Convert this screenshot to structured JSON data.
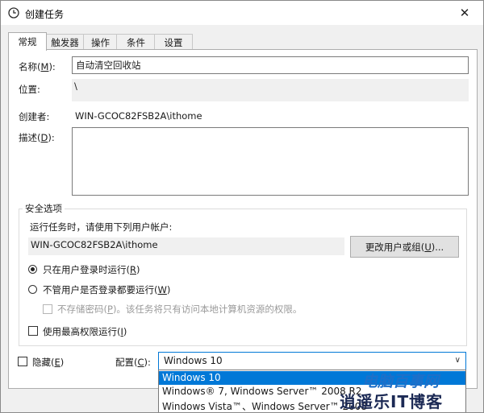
{
  "window": {
    "title": "创建任务",
    "close_glyph": "✕"
  },
  "tabs": [
    {
      "label": "常规",
      "active": true
    },
    {
      "label": "触发器",
      "active": false
    },
    {
      "label": "操作",
      "active": false
    },
    {
      "label": "条件",
      "active": false
    },
    {
      "label": "设置",
      "active": false
    }
  ],
  "general": {
    "name_label": "名称(",
    "name_key": "M",
    "name_label_end": "):",
    "name_value": "自动清空回收站",
    "location_label": "位置:",
    "location_value": "\\",
    "author_label": "创建者:",
    "author_value": "WIN-GCOC82FSB2A\\ithome",
    "description_label": "描述(",
    "description_key": "D",
    "description_label_end": "):",
    "description_value": ""
  },
  "security": {
    "group_title": "安全选项",
    "run_as_prompt": "运行任务时，请使用下列用户帐户:",
    "user_account": "WIN-GCOC82FSB2A\\ithome",
    "change_user_button": "更改用户或组(",
    "change_user_key": "U",
    "change_user_end": ")...",
    "radio_logged_on": "只在用户登录时运行(",
    "radio_logged_on_key": "R",
    "radio_logged_on_end": ")",
    "radio_logged_on_selected": true,
    "radio_whether": "不管用户是否登录都要运行(",
    "radio_whether_key": "W",
    "radio_whether_end": ")",
    "radio_whether_selected": false,
    "no_store_password": "不存储密码(",
    "no_store_password_key": "P",
    "no_store_password_end": ")。该任务将只有访问本地计算机资源的权限。",
    "no_store_password_checked": false,
    "highest_privileges": "使用最高权限运行(",
    "highest_privileges_key": "I",
    "highest_privileges_end": ")",
    "highest_privileges_checked": false
  },
  "footer": {
    "hidden_label": "隐藏(",
    "hidden_key": "E",
    "hidden_end": ")",
    "hidden_checked": false,
    "config_label": "配置(",
    "config_key": "C",
    "config_end": "):",
    "config_value": "Windows 10",
    "config_options": [
      {
        "label": "Windows 10",
        "selected": true
      },
      {
        "label": "Windows® 7, Windows Server™ 2008 R2",
        "selected": false
      },
      {
        "label": "Windows Vista™、Windows Server™ 2008",
        "selected": false
      }
    ]
  },
  "watermark": {
    "line1": "电脑百事网",
    "line2": "逍遥乐IT博客"
  },
  "colors": {
    "accent": "#0078d7",
    "window_bg": "#f0f0f0",
    "border": "#adadad"
  },
  "icons": {
    "title": "task-scheduler-clock-icon",
    "close": "close-icon",
    "dropdown": "chevron-down-icon"
  }
}
